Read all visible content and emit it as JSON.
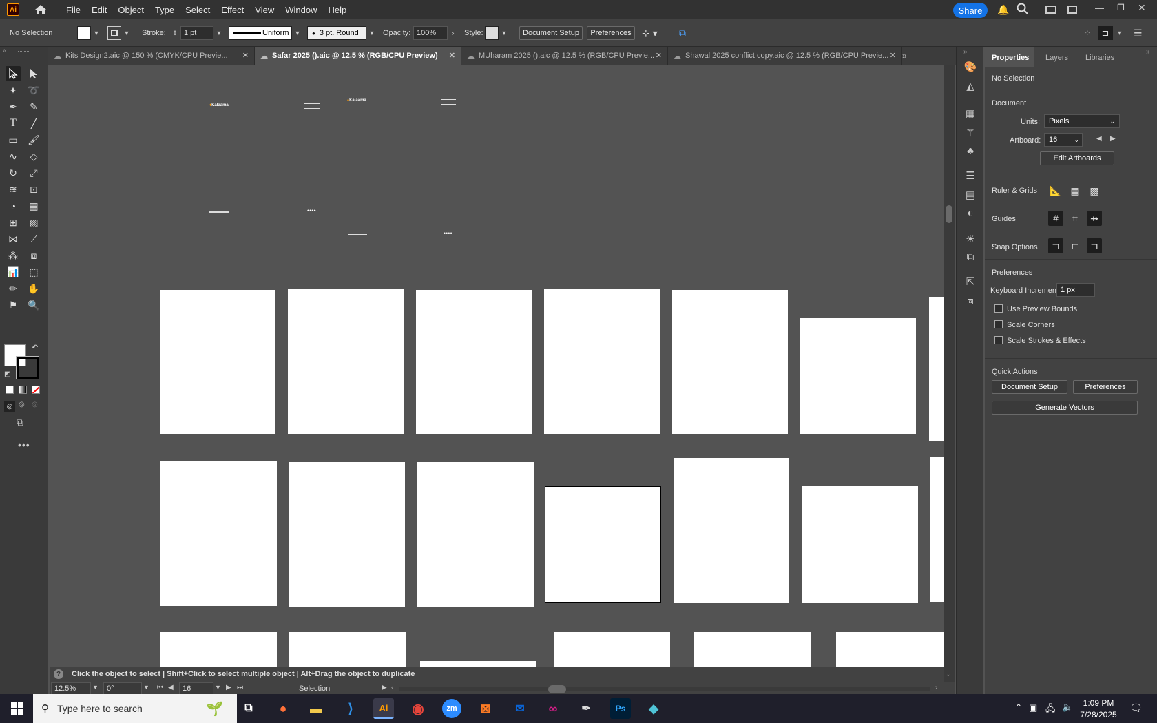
{
  "app": {
    "logo": "Ai"
  },
  "menu": [
    "File",
    "Edit",
    "Object",
    "Type",
    "Select",
    "Effect",
    "View",
    "Window",
    "Help"
  ],
  "share_label": "Share",
  "control": {
    "selection": "No Selection",
    "stroke_label": "Stroke:",
    "stroke_value": "1 pt",
    "stroke_profile": "Uniform",
    "brush": "3 pt. Round",
    "opacity_label": "Opacity:",
    "opacity_value": "100%",
    "style_label": "Style:",
    "doc_setup": "Document Setup",
    "preferences": "Preferences"
  },
  "tabs": [
    {
      "label": "Kits Design2.aic @ 150 % (CMYK/CPU Previe..."
    },
    {
      "label": "Safar 2025 ().aic @ 12.5 % (RGB/CPU Preview)",
      "active": true
    },
    {
      "label": "MUharam 2025 ().aic @ 12.5 % (RGB/CPU Previe..."
    },
    {
      "label": "Shawal 2025 conflict copy.aic @ 12.5 % (RGB/CPU Previe..."
    }
  ],
  "canvas_logo_text": "Kalaama",
  "canvas_dots": "••••",
  "status": {
    "hint": "Click the object to select  |  Shift+Click to select multiple object  |  Alt+Drag the object to duplicate",
    "zoom": "12.5%",
    "rotation": "0°",
    "artboard": "16",
    "tool": "Selection"
  },
  "panel": {
    "tabs": [
      "Properties",
      "Layers",
      "Libraries"
    ],
    "no_selection": "No Selection",
    "document": "Document",
    "units_label": "Units:",
    "units_value": "Pixels",
    "artboard_label": "Artboard:",
    "artboard_value": "16",
    "edit_artboards": "Edit Artboards",
    "ruler_grids": "Ruler & Grids",
    "guides": "Guides",
    "snap_options": "Snap Options",
    "preferences": "Preferences",
    "keyboard_increment_label": "Keyboard Increment:",
    "keyboard_increment_value": "1 px",
    "check_preview_bounds": "Use Preview Bounds",
    "check_scale_corners": "Scale Corners",
    "check_scale_strokes": "Scale Strokes & Effects",
    "quick_actions": "Quick Actions",
    "qa_doc_setup": "Document Setup",
    "qa_preferences": "Preferences",
    "qa_generate": "Generate Vectors"
  },
  "taskbar": {
    "search_placeholder": "Type here to search",
    "time": "1:09 PM",
    "date": "7/28/2025"
  },
  "colors": {
    "accent": "#1473e6",
    "ai_orange": "#ff9a00"
  }
}
